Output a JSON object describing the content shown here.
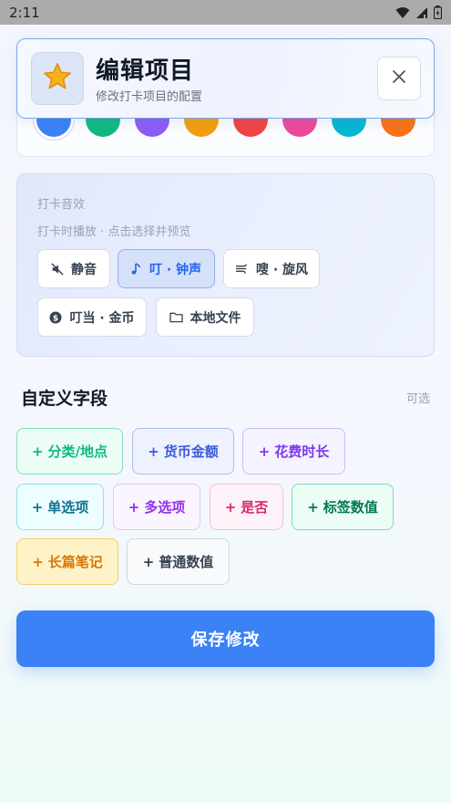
{
  "status_bar": {
    "time": "2:11"
  },
  "header": {
    "title": "编辑项目",
    "subtitle": "修改打卡项目的配置",
    "icon": "star-icon"
  },
  "colors": [
    "#3b82f6",
    "#10b981",
    "#8b5cf6",
    "#f59e0b",
    "#ef4444",
    "#ec4899",
    "#06b6d4",
    "#f97316"
  ],
  "sound": {
    "label": "打卡音效",
    "hint": "打卡时播放 · 点击选择并预览",
    "options": [
      {
        "label": "静音",
        "icon": "mute-icon"
      },
      {
        "label": "叮 · 钟声",
        "icon": "music-note-icon",
        "selected": true
      },
      {
        "label": "嗖 · 旋风",
        "icon": "wind-icon"
      },
      {
        "label": "叮当 · 金币",
        "icon": "coin-icon"
      },
      {
        "label": "本地文件",
        "icon": "folder-icon"
      }
    ]
  },
  "custom_fields": {
    "title": "自定义字段",
    "optional": "可选",
    "plus": "+",
    "items": [
      {
        "label": "分类/地点",
        "color": "#10b981"
      },
      {
        "label": "货币金额",
        "color": "#3b5bdb"
      },
      {
        "label": "花费时长",
        "color": "#7c3aed"
      },
      {
        "label": "单选项",
        "color": "#0e7490"
      },
      {
        "label": "多选项",
        "color": "#9333ea"
      },
      {
        "label": "是否",
        "color": "#db2777"
      },
      {
        "label": "标签数值",
        "color": "#047857"
      },
      {
        "label": "长篇笔记",
        "color": "#d97706"
      },
      {
        "label": "普通数值",
        "color": "#374151"
      }
    ]
  },
  "save_label": "保存修改"
}
